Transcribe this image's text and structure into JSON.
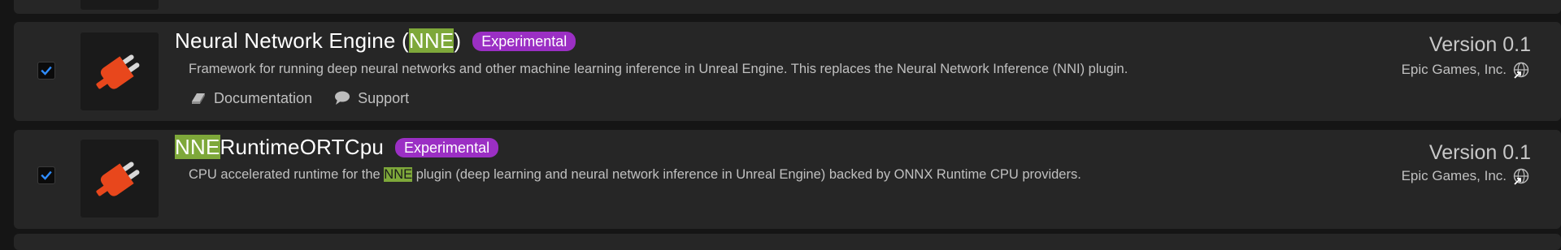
{
  "search_term": "NNE",
  "plugins": [
    {
      "enabled": true,
      "title_before": "Neural Network Engine (",
      "title_match": "NNE",
      "title_after": ")",
      "badge": "Experimental",
      "description": "Framework for running deep neural networks and other machine learning inference in Unreal Engine. This replaces the Neural Network Inference (NNI) plugin.",
      "links": {
        "documentation": "Documentation",
        "support": "Support"
      },
      "version": "Version 0.1",
      "vendor": "Epic Games, Inc."
    },
    {
      "enabled": true,
      "title_match": "NNE",
      "title_after": "RuntimeORTCpu",
      "badge": "Experimental",
      "description_before": "CPU accelerated runtime for the ",
      "description_match": "NNE",
      "description_after": " plugin (deep learning and neural network inference in Unreal Engine) backed by ONNX Runtime CPU providers.",
      "version": "Version 0.1",
      "vendor": "Epic Games, Inc."
    }
  ],
  "icons": {
    "checkbox": "check-icon",
    "plugin": "plug-icon",
    "documentation": "book-icon",
    "support": "speech-bubble-icon",
    "vendor": "globe-link-icon"
  },
  "colors": {
    "background": "#151515",
    "card": "#262626",
    "badge": "#9b2fc4",
    "highlight": "#7ea83a",
    "checkbox_check": "#2f8dff",
    "plug": "#e8471c"
  }
}
